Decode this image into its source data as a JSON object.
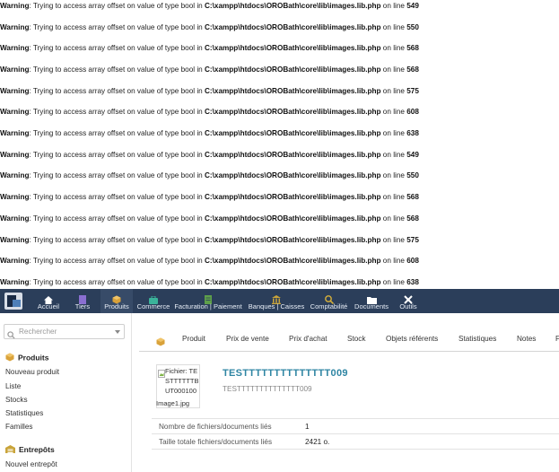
{
  "warnings": [
    {
      "label": "Warning",
      "message": ": Trying to access array offset on value of type bool in ",
      "path": "C:\\xampp\\htdocs\\OROBath\\core\\lib\\images.lib.php",
      "suffix": " on line ",
      "line": "549"
    },
    {
      "label": "Warning",
      "message": ": Trying to access array offset on value of type bool in ",
      "path": "C:\\xampp\\htdocs\\OROBath\\core\\lib\\images.lib.php",
      "suffix": " on line ",
      "line": "550"
    },
    {
      "label": "Warning",
      "message": ": Trying to access array offset on value of type bool in ",
      "path": "C:\\xampp\\htdocs\\OROBath\\core\\lib\\images.lib.php",
      "suffix": " on line ",
      "line": "568"
    },
    {
      "label": "Warning",
      "message": ": Trying to access array offset on value of type bool in ",
      "path": "C:\\xampp\\htdocs\\OROBath\\core\\lib\\images.lib.php",
      "suffix": " on line ",
      "line": "568"
    },
    {
      "label": "Warning",
      "message": ": Trying to access array offset on value of type bool in ",
      "path": "C:\\xampp\\htdocs\\OROBath\\core\\lib\\images.lib.php",
      "suffix": " on line ",
      "line": "575"
    },
    {
      "label": "Warning",
      "message": ": Trying to access array offset on value of type bool in ",
      "path": "C:\\xampp\\htdocs\\OROBath\\core\\lib\\images.lib.php",
      "suffix": " on line ",
      "line": "608"
    },
    {
      "label": "Warning",
      "message": ": Trying to access array offset on value of type bool in ",
      "path": "C:\\xampp\\htdocs\\OROBath\\core\\lib\\images.lib.php",
      "suffix": " on line ",
      "line": "638"
    },
    {
      "label": "Warning",
      "message": ": Trying to access array offset on value of type bool in ",
      "path": "C:\\xampp\\htdocs\\OROBath\\core\\lib\\images.lib.php",
      "suffix": " on line ",
      "line": "549"
    },
    {
      "label": "Warning",
      "message": ": Trying to access array offset on value of type bool in ",
      "path": "C:\\xampp\\htdocs\\OROBath\\core\\lib\\images.lib.php",
      "suffix": " on line ",
      "line": "550"
    },
    {
      "label": "Warning",
      "message": ": Trying to access array offset on value of type bool in ",
      "path": "C:\\xampp\\htdocs\\OROBath\\core\\lib\\images.lib.php",
      "suffix": " on line ",
      "line": "568"
    },
    {
      "label": "Warning",
      "message": ": Trying to access array offset on value of type bool in ",
      "path": "C:\\xampp\\htdocs\\OROBath\\core\\lib\\images.lib.php",
      "suffix": " on line ",
      "line": "568"
    },
    {
      "label": "Warning",
      "message": ": Trying to access array offset on value of type bool in ",
      "path": "C:\\xampp\\htdocs\\OROBath\\core\\lib\\images.lib.php",
      "suffix": " on line ",
      "line": "575"
    },
    {
      "label": "Warning",
      "message": ": Trying to access array offset on value of type bool in ",
      "path": "C:\\xampp\\htdocs\\OROBath\\core\\lib\\images.lib.php",
      "suffix": " on line ",
      "line": "608"
    },
    {
      "label": "Warning",
      "message": ": Trying to access array offset on value of type bool in ",
      "path": "C:\\xampp\\htdocs\\OROBath\\core\\lib\\images.lib.php",
      "suffix": " on line ",
      "line": "638"
    }
  ],
  "topbar": {
    "items": [
      {
        "label": "Accueil",
        "icon": "home-icon",
        "color": "#ffffff"
      },
      {
        "label": "Tiers",
        "icon": "building-icon",
        "color": "#8a6fd1"
      },
      {
        "label": "Produits",
        "icon": "cube-icon",
        "color": "#d9a23a"
      },
      {
        "label": "Commerce",
        "icon": "briefcase-icon",
        "color": "#3bb39a"
      },
      {
        "label": "Facturation | Paiement",
        "icon": "invoice-icon",
        "color": "#5ea04a"
      },
      {
        "label": "Banques | Caisses",
        "icon": "bank-icon",
        "color": "#c9a43a"
      },
      {
        "label": "Comptabilité",
        "icon": "search-dollar-icon",
        "color": "#d8b13a"
      },
      {
        "label": "Documents",
        "icon": "folder-icon",
        "color": "#ffffff"
      },
      {
        "label": "Outils",
        "icon": "tools-icon",
        "color": "#ffffff"
      }
    ]
  },
  "sidebar": {
    "search_placeholder": "Rechercher",
    "sections": [
      {
        "title": "Produits",
        "icon": "cube-icon",
        "links": [
          "Nouveau produit",
          "Liste",
          "Stocks",
          "Statistiques",
          "Familles"
        ]
      },
      {
        "title": "Entrepôts",
        "icon": "warehouse-icon",
        "links": [
          "Nouvel entrepôt"
        ]
      }
    ]
  },
  "tabs": [
    {
      "label": "Produit"
    },
    {
      "label": "Prix de vente"
    },
    {
      "label": "Prix d'achat"
    },
    {
      "label": "Stock"
    },
    {
      "label": "Objets référents"
    },
    {
      "label": "Statistiques"
    },
    {
      "label": "Notes"
    },
    {
      "label": "F"
    }
  ],
  "product": {
    "image_alt": "Fichier: TESTTTTTTBUT000100",
    "image_caption": "Image1.jpg",
    "ref": "TESTTTTTTTTTTTTTT009",
    "label": "TESTTTTTTTTTTTTTT009"
  },
  "info": [
    {
      "key": "Nombre de fichiers/documents liés",
      "value": "1"
    },
    {
      "key": "Taille totale fichiers/documents liés",
      "value": "2421 o."
    }
  ],
  "colors": {
    "topbar_bg": "#2b3e5a",
    "accent": "#2e85a3"
  }
}
